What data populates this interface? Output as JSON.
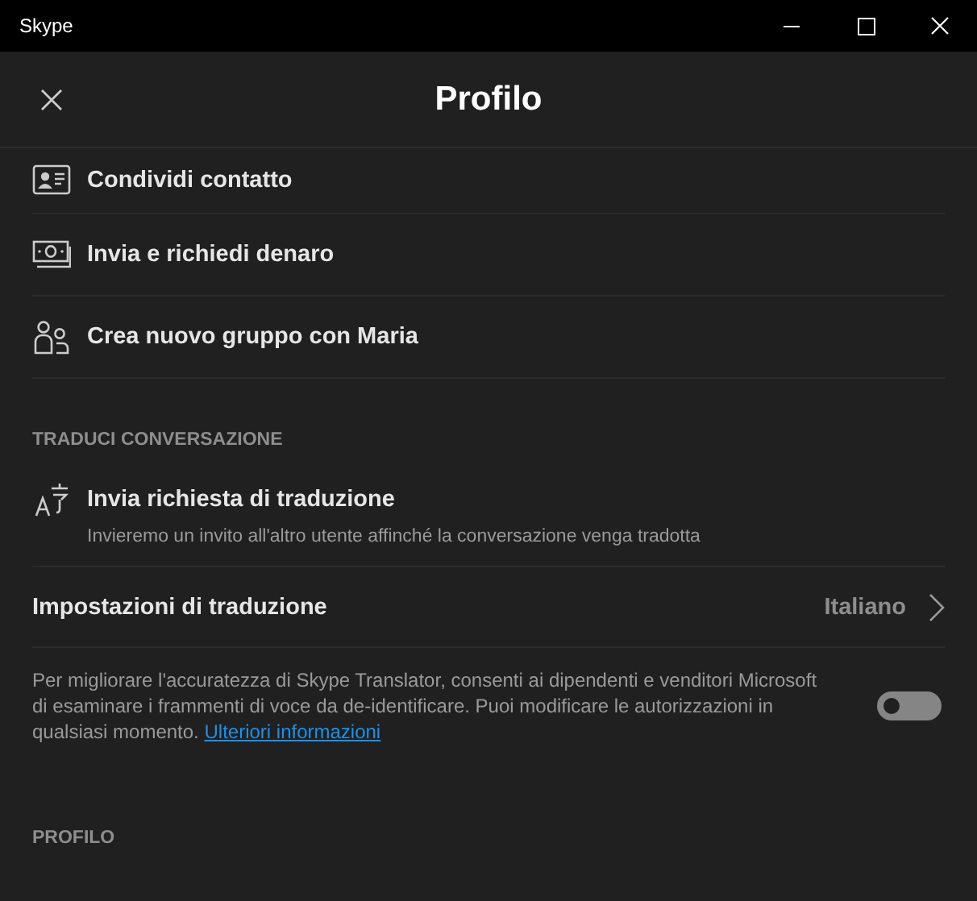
{
  "window": {
    "title": "Skype"
  },
  "header": {
    "title": "Profilo"
  },
  "actions": [
    {
      "kind": "contact-card",
      "label": "Condividi contatto"
    },
    {
      "kind": "money",
      "label": "Invia e richiedi denaro"
    },
    {
      "kind": "group",
      "label": "Crea nuovo gruppo con Maria"
    }
  ],
  "translate_section": {
    "heading": "TRADUCI CONVERSAZIONE",
    "request": {
      "kind": "translate",
      "label": "Invia richiesta di traduzione",
      "description": "Invieremo un invito all'altro utente affinché la conversazione venga tradotta"
    },
    "settings": {
      "label": "Impostazioni di traduzione",
      "value": "Italiano"
    },
    "consent": {
      "text": "Per migliorare l'accuratezza di Skype Translator, consenti ai dipendenti e venditori Microsoft di esaminare i frammenti di voce da de-identificare. Puoi modificare le autorizzazioni in qualsiasi momento.",
      "link": "Ulteriori informazioni",
      "on": false
    }
  },
  "profile_section": {
    "heading": "PROFILO"
  }
}
